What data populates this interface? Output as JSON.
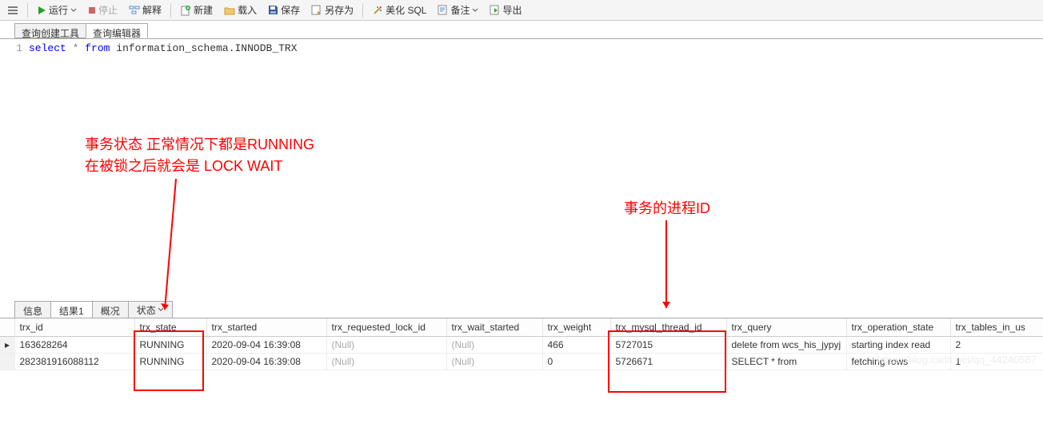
{
  "toolbar": {
    "run": "运行",
    "stop": "停止",
    "explain": "解释",
    "new": "新建",
    "load": "载入",
    "save": "保存",
    "save_as": "另存为",
    "beautify": "美化 SQL",
    "note": "备注",
    "export": "导出"
  },
  "top_tabs": {
    "builder": "查询创建工具",
    "editor": "查询编辑器"
  },
  "sql": {
    "line_no": "1",
    "kw_select": "select",
    "star": "*",
    "kw_from": "from",
    "table": "information_schema.INNODB_TRX"
  },
  "annotations": {
    "state_line1": "事务状态 正常情况下都是RUNNING",
    "state_line2": "在被锁之后就会是 LOCK WAIT",
    "thread": "事务的进程ID"
  },
  "result_tabs": {
    "info": "信息",
    "result1": "结果1",
    "profile": "概况",
    "status": "状态"
  },
  "columns": {
    "c0": "trx_id",
    "c1": "trx_state",
    "c2": "trx_started",
    "c3": "trx_requested_lock_id",
    "c4": "trx_wait_started",
    "c5": "trx_weight",
    "c6": "trx_mysql_thread_id",
    "c7": "trx_query",
    "c8": "trx_operation_state",
    "c9": "trx_tables_in_us"
  },
  "rows": [
    {
      "trx_id": "163628264",
      "trx_state": "RUNNING",
      "trx_started": "2020-09-04 16:39:08",
      "trx_requested_lock_id": "(Null)",
      "trx_wait_started": "(Null)",
      "trx_weight": "466",
      "trx_mysql_thread_id": "5727015",
      "trx_query": "delete from wcs_his_jypyj",
      "trx_operation_state": "starting index read",
      "trx_tables_in_use": "2"
    },
    {
      "trx_id": "282381916088112",
      "trx_state": "RUNNING",
      "trx_started": "2020-09-04 16:39:08",
      "trx_requested_lock_id": "(Null)",
      "trx_wait_started": "(Null)",
      "trx_weight": "0",
      "trx_mysql_thread_id": "5726671",
      "trx_query": "SELECT       *       from ",
      "trx_operation_state": "fetching rows",
      "trx_tables_in_use": "1"
    }
  ],
  "watermark": "https://blog.csdn.net/qq_44240587"
}
